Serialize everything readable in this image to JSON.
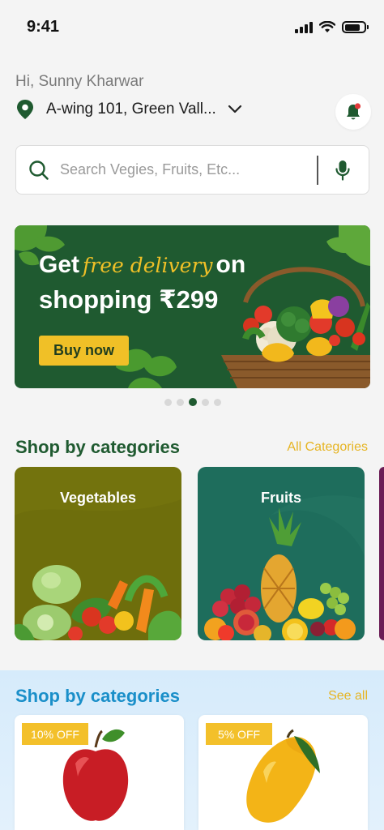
{
  "status_bar": {
    "time": "9:41"
  },
  "header": {
    "greeting": "Hi, Sunny Kharwar",
    "address": "A-wing 101, Green Vall..."
  },
  "search": {
    "placeholder": "Search Vegies, Fruits, Etc..."
  },
  "banner": {
    "line1_start": "Get",
    "line1_accent": "free delivery",
    "line1_end": "on",
    "line2": "shopping ₹299",
    "button_label": "Buy now",
    "carousel": {
      "count": 5,
      "active_index": 2
    }
  },
  "categories_section": {
    "title": "Shop by categories",
    "link_label": "All Categories",
    "items": [
      {
        "label": "Vegetables",
        "color": "#6e6e0c"
      },
      {
        "label": "Fruits",
        "color": "#1e6d5c"
      }
    ]
  },
  "offers_section": {
    "title": "Shop by categories",
    "link_label": "See all",
    "products": [
      {
        "badge": "10% OFF",
        "icon": "apple"
      },
      {
        "badge": "5% OFF",
        "icon": "mango"
      }
    ]
  },
  "colors": {
    "brand_green": "#1f5a30",
    "accent_yellow": "#f0c027",
    "section_blue": "#1a8fc9"
  }
}
